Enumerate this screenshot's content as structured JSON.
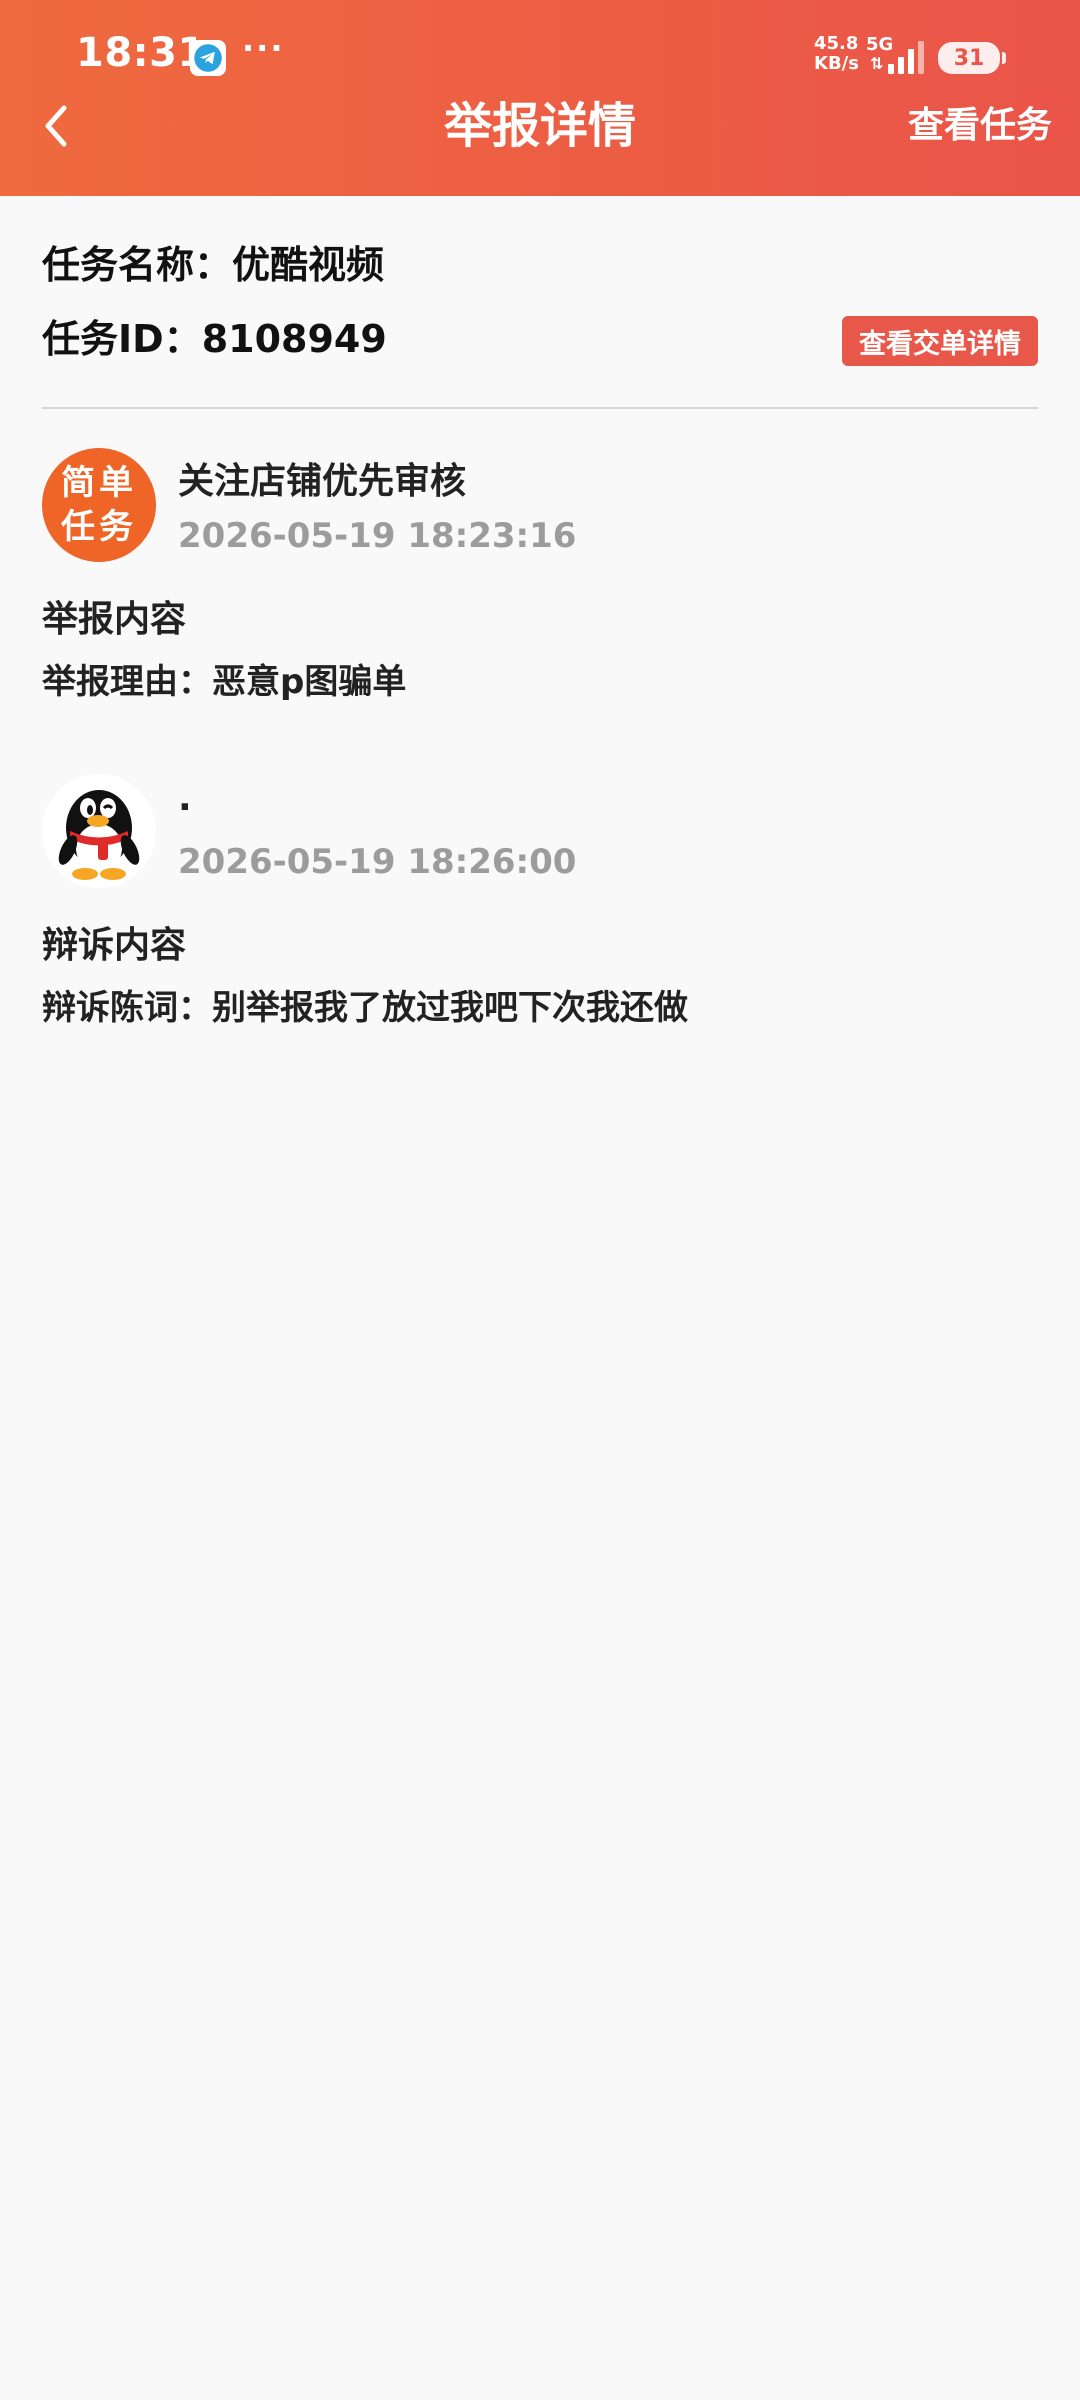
{
  "status_bar": {
    "time": "18:31",
    "dots": "···",
    "net_speed_value": "45.8",
    "net_speed_unit": "KB/s",
    "network": "5G",
    "battery": "31",
    "icons": [
      "telegram-icon",
      "signal-icon",
      "battery-icon"
    ]
  },
  "nav": {
    "title": "举报详情",
    "right_action": "查看任务",
    "back_icon": "chevron-left-icon"
  },
  "task": {
    "name_label": "任务名称：",
    "name_value": "优酷视频",
    "id_label": "任务ID：",
    "id_value": "8108949",
    "view_order_button": "查看交单详情"
  },
  "report": {
    "avatar_line1": "简单",
    "avatar_line2": "任务",
    "title": "关注店铺优先审核",
    "time": "2026-05-19 18:23:16",
    "section_title": "举报内容",
    "reason": "举报理由：恶意p图骗单"
  },
  "appeal": {
    "avatar_icon": "qq-penguin-icon",
    "title": ".",
    "time": "2026-05-19 18:26:00",
    "section_title": "辩诉内容",
    "statement": "辩诉陈词：别举报我了放过我吧下次我还做"
  },
  "colors": {
    "header_start": "#ef6a3e",
    "header_end": "#ea5449",
    "button": "#e8584a",
    "avatar_orange": "#ee6527",
    "muted_text": "#9c9c9c",
    "background": "#f9f9f9"
  }
}
